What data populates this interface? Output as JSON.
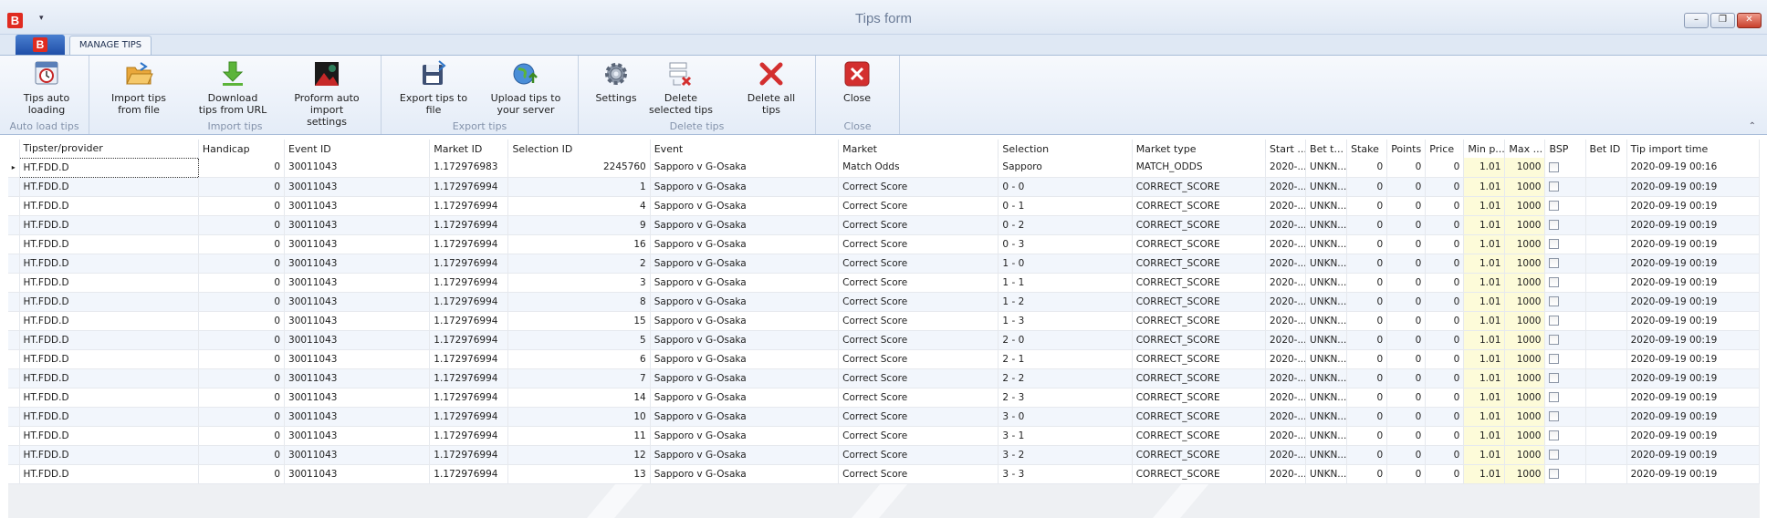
{
  "window": {
    "title": "Tips form",
    "qat_arrow": "▾",
    "app_letter": "B",
    "minimize": "–",
    "restore": "❐",
    "close": "✕"
  },
  "tabs": [
    {
      "label": "MANAGE TIPS"
    }
  ],
  "ribbon": {
    "groups": [
      {
        "label": "Auto load tips",
        "buttons": [
          {
            "label": "Tips auto loading",
            "icon": "auto-load-icon"
          }
        ]
      },
      {
        "label": "Import tips",
        "buttons": [
          {
            "label": "Import tips from file",
            "icon": "folder-open-icon"
          },
          {
            "label": "Download tips from URL",
            "icon": "download-icon"
          },
          {
            "label": "Proform auto import settings",
            "icon": "proform-icon"
          }
        ]
      },
      {
        "label": "Export tips",
        "buttons": [
          {
            "label": "Export tips to file",
            "icon": "save-icon"
          },
          {
            "label": "Upload tips to your server",
            "icon": "upload-globe-icon"
          }
        ]
      },
      {
        "label": "Delete tips",
        "buttons": [
          {
            "label": "Settings",
            "icon": "gear-icon"
          },
          {
            "label": "Delete selected tips",
            "icon": "delete-selected-icon"
          },
          {
            "label": "Delete all tips",
            "icon": "delete-all-icon"
          }
        ]
      },
      {
        "label": "Close",
        "buttons": [
          {
            "label": "Close",
            "icon": "close-icon"
          }
        ]
      }
    ],
    "collapse": "⌃"
  },
  "grid": {
    "columns": [
      "Tipster/provider",
      "Handicap",
      "Event ID",
      "Market ID",
      "Selection ID",
      "Event",
      "Market",
      "Selection",
      "Market type",
      "Start ...",
      "Bet t...",
      "Stake",
      "Points",
      "Price",
      "Min p...",
      "Max ...",
      "BSP",
      "Bet ID",
      "Tip import time"
    ],
    "rows": [
      [
        "HT.FDD.D",
        "0",
        "30011043",
        "1.172976983",
        "2245760",
        "Sapporo v G-Osaka",
        "Match Odds",
        "Sapporo",
        "MATCH_ODDS",
        "2020-...",
        "UNKN...",
        "0",
        "0",
        "0",
        "1.01",
        "1000",
        "",
        "",
        "2020-09-19 00:16"
      ],
      [
        "HT.FDD.D",
        "0",
        "30011043",
        "1.172976994",
        "1",
        "Sapporo v G-Osaka",
        "Correct Score",
        "0 - 0",
        "CORRECT_SCORE",
        "2020-...",
        "UNKN...",
        "0",
        "0",
        "0",
        "1.01",
        "1000",
        "",
        "",
        "2020-09-19 00:19"
      ],
      [
        "HT.FDD.D",
        "0",
        "30011043",
        "1.172976994",
        "4",
        "Sapporo v G-Osaka",
        "Correct Score",
        "0 - 1",
        "CORRECT_SCORE",
        "2020-...",
        "UNKN...",
        "0",
        "0",
        "0",
        "1.01",
        "1000",
        "",
        "",
        "2020-09-19 00:19"
      ],
      [
        "HT.FDD.D",
        "0",
        "30011043",
        "1.172976994",
        "9",
        "Sapporo v G-Osaka",
        "Correct Score",
        "0 - 2",
        "CORRECT_SCORE",
        "2020-...",
        "UNKN...",
        "0",
        "0",
        "0",
        "1.01",
        "1000",
        "",
        "",
        "2020-09-19 00:19"
      ],
      [
        "HT.FDD.D",
        "0",
        "30011043",
        "1.172976994",
        "16",
        "Sapporo v G-Osaka",
        "Correct Score",
        "0 - 3",
        "CORRECT_SCORE",
        "2020-...",
        "UNKN...",
        "0",
        "0",
        "0",
        "1.01",
        "1000",
        "",
        "",
        "2020-09-19 00:19"
      ],
      [
        "HT.FDD.D",
        "0",
        "30011043",
        "1.172976994",
        "2",
        "Sapporo v G-Osaka",
        "Correct Score",
        "1 - 0",
        "CORRECT_SCORE",
        "2020-...",
        "UNKN...",
        "0",
        "0",
        "0",
        "1.01",
        "1000",
        "",
        "",
        "2020-09-19 00:19"
      ],
      [
        "HT.FDD.D",
        "0",
        "30011043",
        "1.172976994",
        "3",
        "Sapporo v G-Osaka",
        "Correct Score",
        "1 - 1",
        "CORRECT_SCORE",
        "2020-...",
        "UNKN...",
        "0",
        "0",
        "0",
        "1.01",
        "1000",
        "",
        "",
        "2020-09-19 00:19"
      ],
      [
        "HT.FDD.D",
        "0",
        "30011043",
        "1.172976994",
        "8",
        "Sapporo v G-Osaka",
        "Correct Score",
        "1 - 2",
        "CORRECT_SCORE",
        "2020-...",
        "UNKN...",
        "0",
        "0",
        "0",
        "1.01",
        "1000",
        "",
        "",
        "2020-09-19 00:19"
      ],
      [
        "HT.FDD.D",
        "0",
        "30011043",
        "1.172976994",
        "15",
        "Sapporo v G-Osaka",
        "Correct Score",
        "1 - 3",
        "CORRECT_SCORE",
        "2020-...",
        "UNKN...",
        "0",
        "0",
        "0",
        "1.01",
        "1000",
        "",
        "",
        "2020-09-19 00:19"
      ],
      [
        "HT.FDD.D",
        "0",
        "30011043",
        "1.172976994",
        "5",
        "Sapporo v G-Osaka",
        "Correct Score",
        "2 - 0",
        "CORRECT_SCORE",
        "2020-...",
        "UNKN...",
        "0",
        "0",
        "0",
        "1.01",
        "1000",
        "",
        "",
        "2020-09-19 00:19"
      ],
      [
        "HT.FDD.D",
        "0",
        "30011043",
        "1.172976994",
        "6",
        "Sapporo v G-Osaka",
        "Correct Score",
        "2 - 1",
        "CORRECT_SCORE",
        "2020-...",
        "UNKN...",
        "0",
        "0",
        "0",
        "1.01",
        "1000",
        "",
        "",
        "2020-09-19 00:19"
      ],
      [
        "HT.FDD.D",
        "0",
        "30011043",
        "1.172976994",
        "7",
        "Sapporo v G-Osaka",
        "Correct Score",
        "2 - 2",
        "CORRECT_SCORE",
        "2020-...",
        "UNKN...",
        "0",
        "0",
        "0",
        "1.01",
        "1000",
        "",
        "",
        "2020-09-19 00:19"
      ],
      [
        "HT.FDD.D",
        "0",
        "30011043",
        "1.172976994",
        "14",
        "Sapporo v G-Osaka",
        "Correct Score",
        "2 - 3",
        "CORRECT_SCORE",
        "2020-...",
        "UNKN...",
        "0",
        "0",
        "0",
        "1.01",
        "1000",
        "",
        "",
        "2020-09-19 00:19"
      ],
      [
        "HT.FDD.D",
        "0",
        "30011043",
        "1.172976994",
        "10",
        "Sapporo v G-Osaka",
        "Correct Score",
        "3 - 0",
        "CORRECT_SCORE",
        "2020-...",
        "UNKN...",
        "0",
        "0",
        "0",
        "1.01",
        "1000",
        "",
        "",
        "2020-09-19 00:19"
      ],
      [
        "HT.FDD.D",
        "0",
        "30011043",
        "1.172976994",
        "11",
        "Sapporo v G-Osaka",
        "Correct Score",
        "3 - 1",
        "CORRECT_SCORE",
        "2020-...",
        "UNKN...",
        "0",
        "0",
        "0",
        "1.01",
        "1000",
        "",
        "",
        "2020-09-19 00:19"
      ],
      [
        "HT.FDD.D",
        "0",
        "30011043",
        "1.172976994",
        "12",
        "Sapporo v G-Osaka",
        "Correct Score",
        "3 - 2",
        "CORRECT_SCORE",
        "2020-...",
        "UNKN...",
        "0",
        "0",
        "0",
        "1.01",
        "1000",
        "",
        "",
        "2020-09-19 00:19"
      ],
      [
        "HT.FDD.D",
        "0",
        "30011043",
        "1.172976994",
        "13",
        "Sapporo v G-Osaka",
        "Correct Score",
        "3 - 3",
        "CORRECT_SCORE",
        "2020-...",
        "UNKN...",
        "0",
        "0",
        "0",
        "1.01",
        "1000",
        "",
        "",
        "2020-09-19 00:19"
      ]
    ],
    "selected_row": 0,
    "row_indicator": "▸",
    "colors": {
      "alt_row": "#f2f6fc",
      "price_limit_cells": "#fdfbd9",
      "app_red": "#e02b20"
    }
  }
}
